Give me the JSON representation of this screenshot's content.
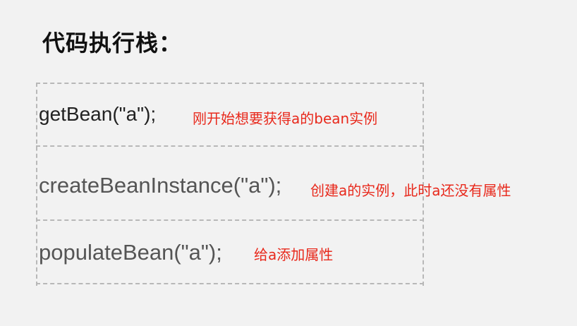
{
  "title": "代码执行栈：",
  "frames": [
    {
      "code": "getBean(\"a\");",
      "note": "刚开始想要获得a的bean实例"
    },
    {
      "code": "createBeanInstance(\"a\");",
      "note": "创建a的实例，此时a还没有属性"
    },
    {
      "code": "populateBean(\"a\");",
      "note": "给a添加属性"
    }
  ],
  "colors": {
    "background": "#f2f2f2",
    "code_text_1": "#222222",
    "code_text_2": "#555555",
    "note_text": "#e8291c",
    "dashed_border": "#b8b8b8"
  }
}
